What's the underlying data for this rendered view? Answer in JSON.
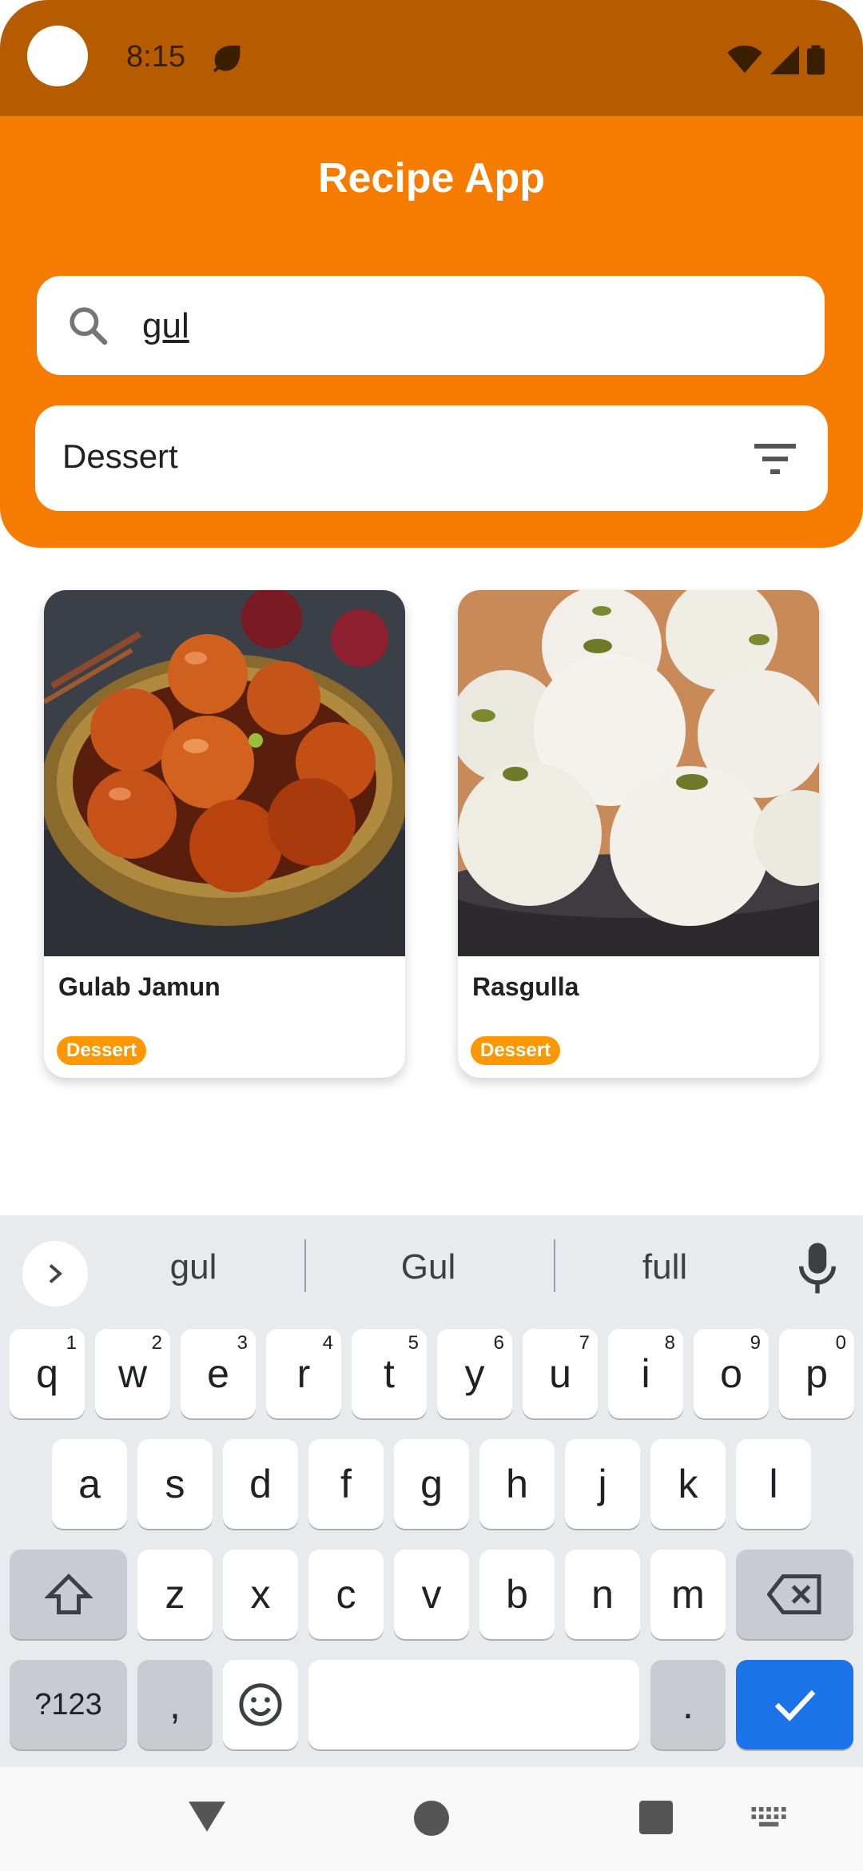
{
  "status": {
    "time": "8:15"
  },
  "header": {
    "title": "Recipe App"
  },
  "search": {
    "value": "gul"
  },
  "filter": {
    "label": "Dessert"
  },
  "cards": [
    {
      "title": "Gulab Jamun",
      "category": "Dessert"
    },
    {
      "title": "Rasgulla",
      "category": "Dessert"
    }
  ],
  "keyboard": {
    "suggestions": [
      "gul",
      "Gul",
      "full"
    ],
    "row1": [
      "q",
      "w",
      "e",
      "r",
      "t",
      "y",
      "u",
      "i",
      "o",
      "p"
    ],
    "row1_nums": [
      "1",
      "2",
      "3",
      "4",
      "5",
      "6",
      "7",
      "8",
      "9",
      "0"
    ],
    "row2": [
      "a",
      "s",
      "d",
      "f",
      "g",
      "h",
      "j",
      "k",
      "l"
    ],
    "row3": [
      "z",
      "x",
      "c",
      "v",
      "b",
      "n",
      "m"
    ],
    "symbols_label": "?123",
    "comma": ",",
    "period": "."
  },
  "colors": {
    "accent": "#f57c00",
    "status_bar": "#b55c00",
    "badge": "#ff9800",
    "enter_key": "#1a73e8"
  }
}
